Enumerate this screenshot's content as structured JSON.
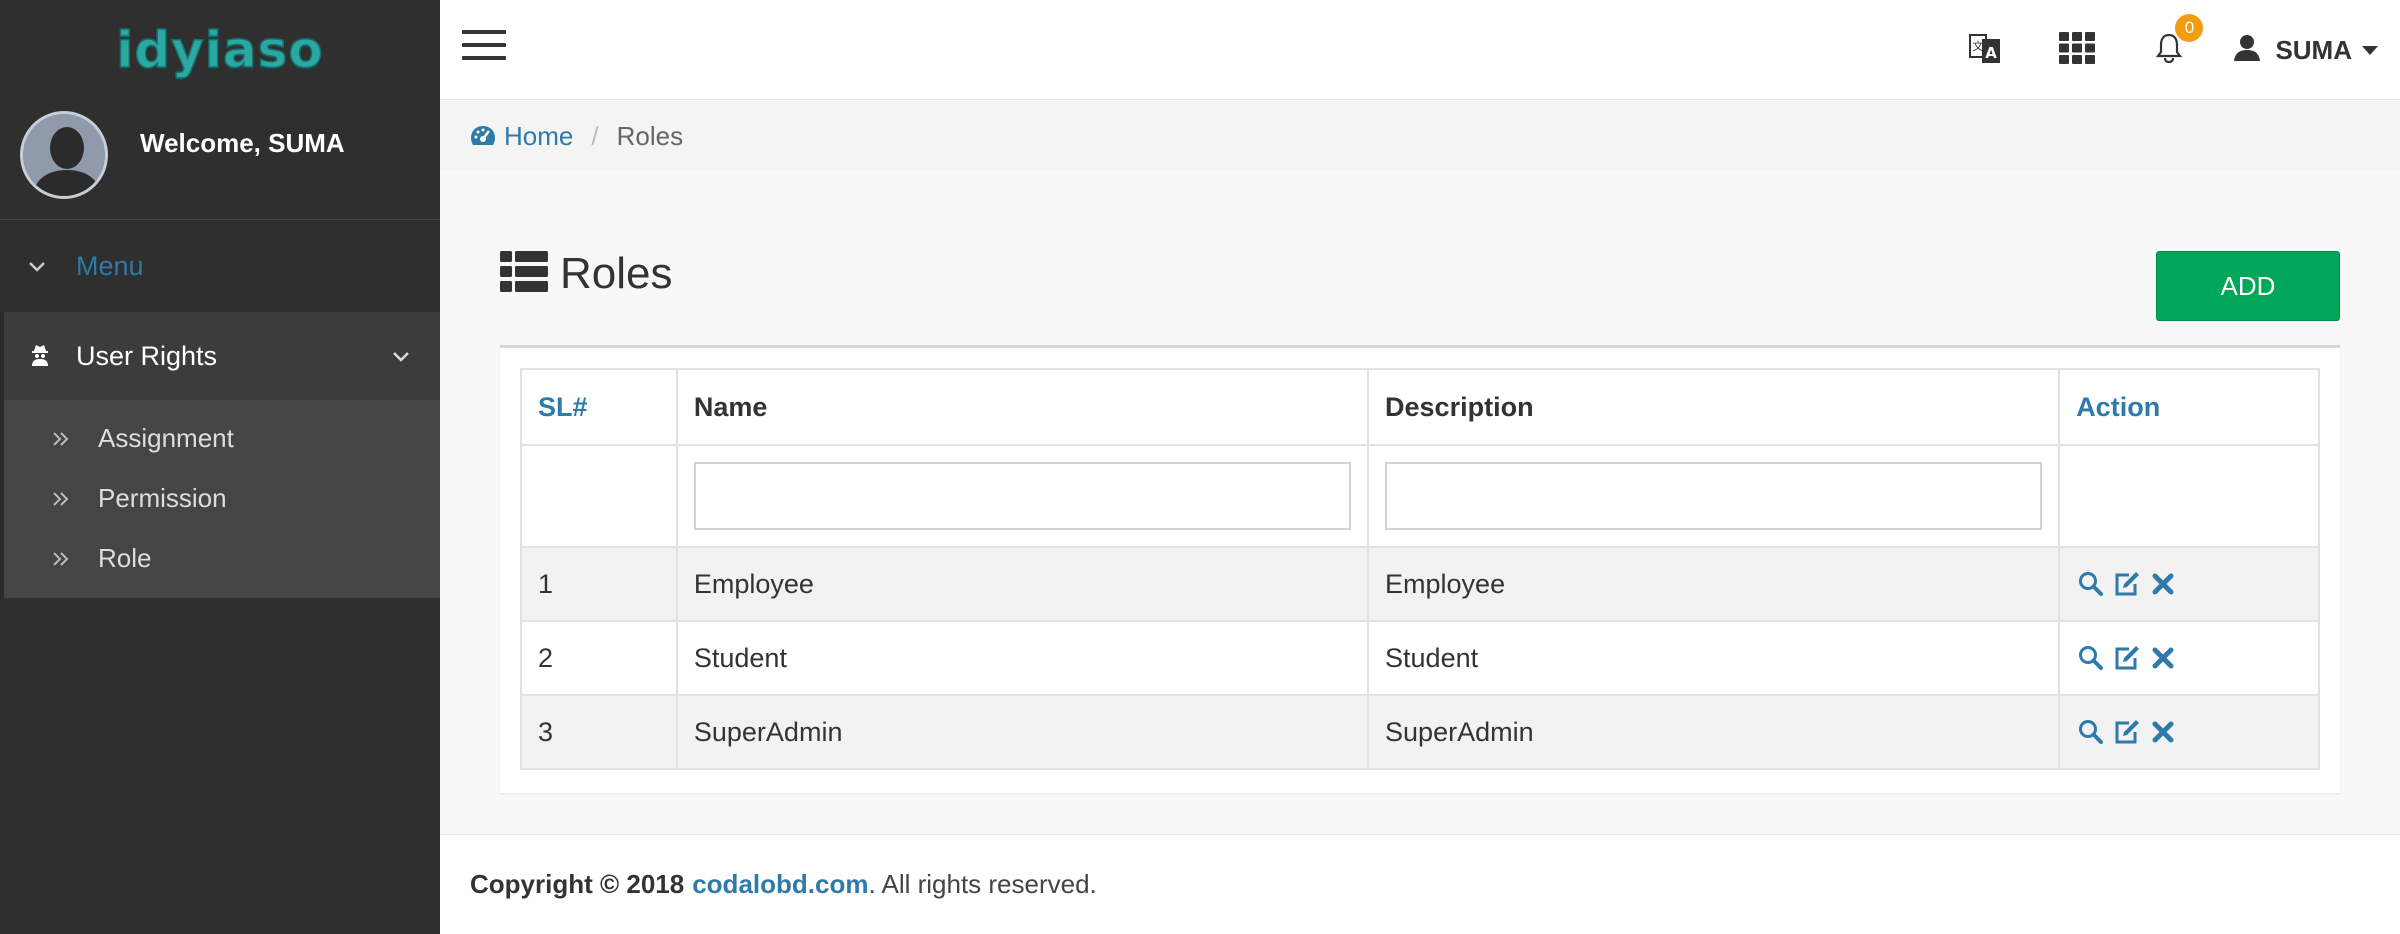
{
  "brand": {
    "logo_text": "idyiaso"
  },
  "sidebar": {
    "welcome": "Welcome, SUMA",
    "menu_label": "Menu",
    "tree": {
      "label": "User Rights",
      "items": [
        {
          "label": "Assignment"
        },
        {
          "label": "Permission"
        },
        {
          "label": "Role"
        }
      ]
    }
  },
  "header": {
    "notifications_count": "0",
    "username": "SUMA"
  },
  "breadcrumb": {
    "home": "Home",
    "current": "Roles"
  },
  "page": {
    "title": "Roles",
    "add_label": "ADD"
  },
  "table": {
    "columns": {
      "sl": "SL#",
      "name": "Name",
      "description": "Description",
      "action": "Action"
    },
    "rows": [
      {
        "sl": "1",
        "name": "Employee",
        "description": "Employee"
      },
      {
        "sl": "2",
        "name": "Student",
        "description": "Student"
      },
      {
        "sl": "3",
        "name": "SuperAdmin",
        "description": "SuperAdmin"
      }
    ]
  },
  "footer": {
    "prefix": "Copyright © 2018",
    "link": "codalobd.com",
    "suffix": ". All rights reserved."
  },
  "colors": {
    "sidebar_bg": "#2f2f2f",
    "link_blue": "#2e7aa8",
    "add_green": "#00a65a",
    "badge_orange": "#f39c12"
  }
}
